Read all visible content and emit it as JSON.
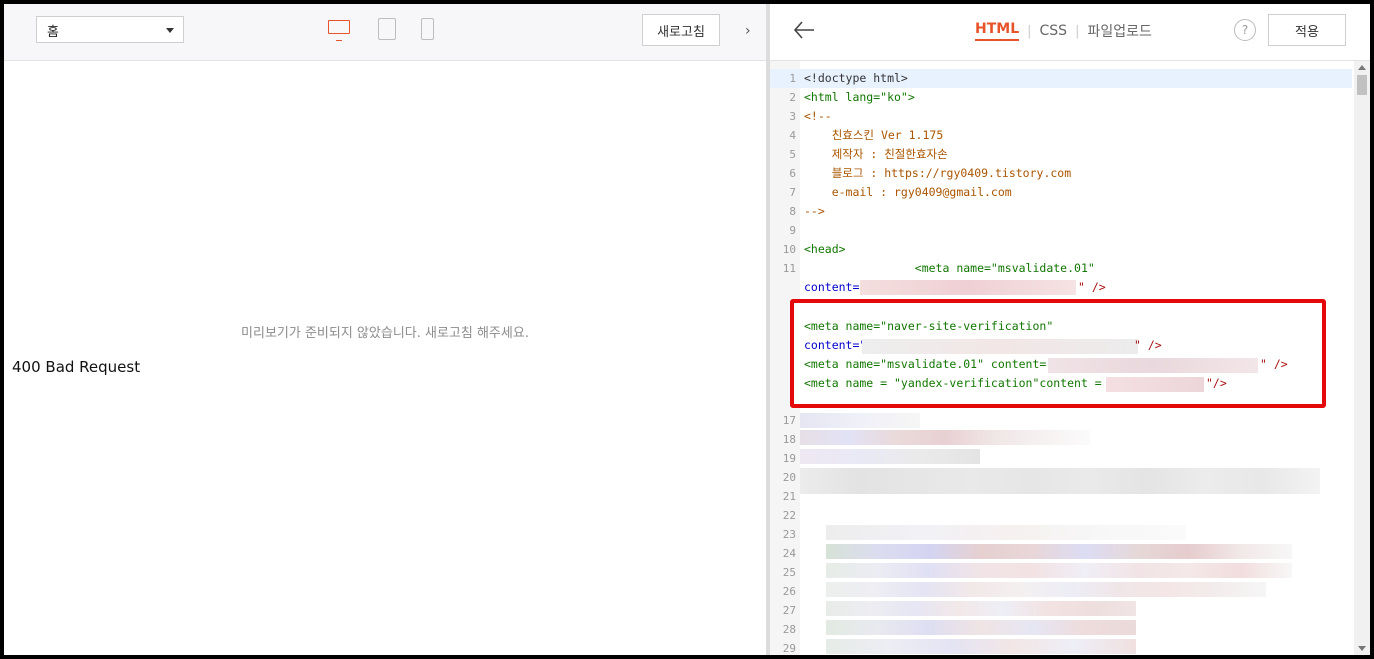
{
  "left": {
    "page_select": "홈",
    "refresh_label": "새로고침",
    "preview_message": "미리보기가 준비되지 않았습니다. 새로고침 해주세요.",
    "error_text": "400 Bad Request"
  },
  "right": {
    "tabs": [
      "HTML",
      "CSS",
      "파일업로드"
    ],
    "active_tab": "HTML",
    "help": "?",
    "apply_label": "적용",
    "colors": {
      "accent": "#e8542a",
      "highlight": "#e4080a"
    }
  },
  "code": {
    "line_numbers": [
      "1",
      "2",
      "3",
      "4",
      "5",
      "6",
      "7",
      "8",
      "9",
      "10",
      "11",
      "17",
      "18",
      "19",
      "20",
      "21",
      "22",
      "23",
      "24",
      "25",
      "26",
      "27",
      "28",
      "29"
    ],
    "l1": "<!doctype html>",
    "l2": "<html lang=\"ko\">",
    "l3": "<!--",
    "l4": "    친효스킨 Ver 1.175",
    "l5": "    제작자 : 친절한효자손",
    "l6": "    블로그 : https://rgy0409.tistory.com",
    "l7": "    e-mail : rgy0409@gmail.com",
    "l8": "-->",
    "l10": "<head>",
    "l11a": "                <meta name=\"msvalidate.01\"",
    "l11b_start": "content=\"",
    "l11b_end": "\" />",
    "h1": "<meta name=\"naver-site-verification\"",
    "h2_start": "content=\"",
    "h2_end": "\" />",
    "h3_start": "<meta name=\"msvalidate.01\" content=\"",
    "h3_end": "\" />",
    "h4_start": "<meta name = \"yandex-verification\"content = \"",
    "h4_end": "\"/>"
  }
}
